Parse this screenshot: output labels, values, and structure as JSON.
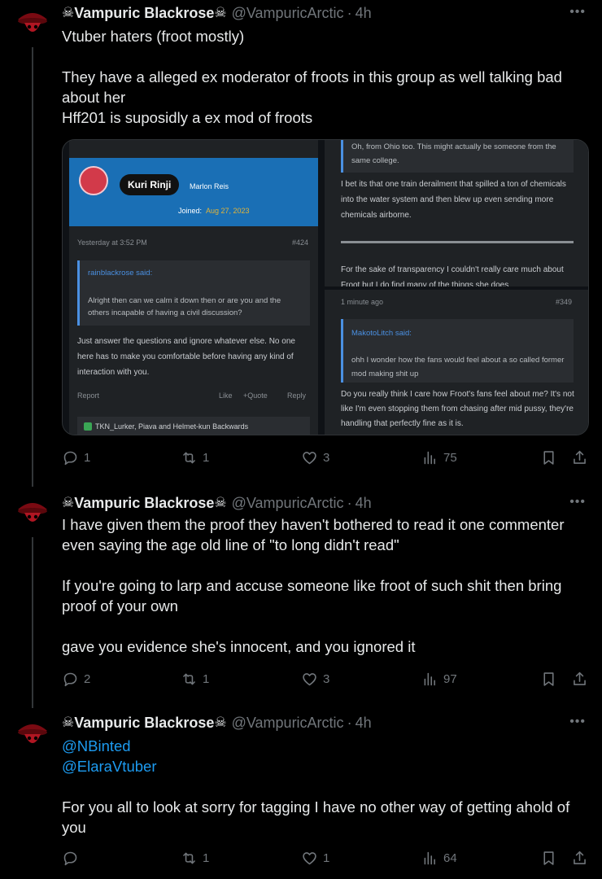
{
  "tweets": [
    {
      "display_name": "Vampuric Blackrose",
      "handle": "@VampuricArctic",
      "dot": "·",
      "time": "4h",
      "text": [
        "Vtuber haters (froot mostly)",
        "",
        "They have a alleged ex moderator of froots in this group as well talking bad about her",
        "Hff201 is suposidly a ex mod of froots"
      ],
      "replies": "1",
      "reposts": "1",
      "likes": "3",
      "views": "75"
    },
    {
      "display_name": "Vampuric Blackrose",
      "handle": "@VampuricArctic",
      "dot": "·",
      "time": "4h",
      "text": [
        "I have given them the proof they haven't bothered to read it one commenter even saying the age old line of \"to long didn't read\"",
        "",
        "If you're going to larp and accuse someone like froot of such shit then bring proof of your own",
        "",
        "gave you evidence she's innocent, and you ignored it"
      ],
      "replies": "2",
      "reposts": "1",
      "likes": "3",
      "views": "97"
    },
    {
      "display_name": "Vampuric Blackrose",
      "handle": "@VampuricArctic",
      "dot": "·",
      "time": "4h",
      "mentions": [
        "@NBinted",
        "@ElaraVtuber"
      ],
      "text": [
        "For you all to look at sorry for tagging I have no other way of getting ahold of you"
      ],
      "replies": "",
      "reposts": "1",
      "likes": "1",
      "views": "64"
    }
  ],
  "media": {
    "left": {
      "user_name": "Kuri Rinji",
      "user_title": "Marlon Reis",
      "joined_label": "Joined:",
      "joined_date": "Aug 27, 2023",
      "post_time": "Yesterday at 3:52 PM",
      "post_num": "#424",
      "quote_author": "rainblackrose said:",
      "quote_text": "Alright then can we calm it down then or are you and the others incapable of having a civil discussion?",
      "reply_text": "Just answer the questions and ignore whatever else. No one here has to make you comfortable before having any kind of interaction with you.",
      "report": "Report",
      "like": "Like",
      "quote": "+Quote",
      "reply": "Reply",
      "reactions": "TKN_Lurker, Piava and Helmet-kun Backwards"
    },
    "top_right": {
      "quote_text": "Oh, from Ohio too. This might actually be someone from the same college.",
      "body": "I bet its that one train derailment that spilled a ton of chemicals into the water system and then blew up even sending more chemicals airborne.",
      "body2": "For the sake of transparency I couldn't really care much about Froot but I do find many of the things she does"
    },
    "bottom_right": {
      "post_time": "1 minute ago",
      "post_num": "#349",
      "quote_author": "MakotoLitch said:",
      "quote_text": "ohh I wonder how the fans would feel about a so called former mod making shit up",
      "body": "Do you really think I care how Froot's fans feel about me? It's not like I'm even stopping them from chasing after mid pussy, they're handling that perfectly fine as it is."
    }
  },
  "colors": {
    "accent": "#1d9bf0",
    "muted": "#71767b",
    "text": "#e7e9ea",
    "forum_blue": "#1a6fb5",
    "forum_bg": "#1f2225"
  }
}
